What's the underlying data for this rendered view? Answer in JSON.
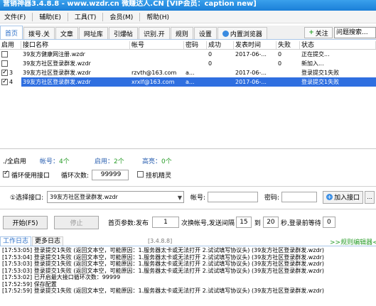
{
  "window": {
    "title": "营销神器3.4.8.8 - www.wzdr.cn 微赚达人.CN [VIP会员：caption new]"
  },
  "menu": [
    {
      "label": "文件(F)"
    },
    {
      "label": "辅助(E)"
    },
    {
      "label": "工具(T)"
    },
    {
      "label": "会员(M)"
    },
    {
      "label": "帮助(H)"
    }
  ],
  "tabs": [
    {
      "label": "首页",
      "active": true
    },
    {
      "label": "拨号.关"
    },
    {
      "label": "文章"
    },
    {
      "label": "网址库"
    },
    {
      "label": "引爆帖"
    },
    {
      "label": "识别.开"
    },
    {
      "label": "规则"
    },
    {
      "label": "设置"
    },
    {
      "label": "内置浏览器",
      "icon": "globe-icon"
    }
  ],
  "toolbar": {
    "follow_label": "关注",
    "search_value": "问题搜索..."
  },
  "grid": {
    "columns": [
      "启用",
      "接口名称",
      "帐号",
      "密码",
      "成功",
      "发表时间",
      "失败",
      "状态"
    ],
    "rows": [
      {
        "enabled": false,
        "num": "",
        "name": "39友方健康网注册.wzdr",
        "account": "",
        "password": "",
        "success": "0",
        "time": "2017-06-...",
        "fail": "0",
        "status": "正在提交...",
        "selected": false
      },
      {
        "enabled": false,
        "num": "",
        "name": "39友方社区登录群发.wzdr",
        "account": "",
        "password": "",
        "success": "0",
        "time": "",
        "fail": "0",
        "status": "新加入...",
        "selected": false
      },
      {
        "enabled": true,
        "num": "3",
        "name": "39友方社区登录群发.wzdr",
        "account": "rzvth@163.com",
        "password": "a...",
        "success": "",
        "time": "2017-06-...",
        "fail": "",
        "status": "登录提交1失败",
        "selected": false
      },
      {
        "enabled": true,
        "num": "4",
        "name": "39友方社区登录群发.wzdr",
        "account": "xrxlf@163.com",
        "password": "a...",
        "success": "",
        "time": "2017-06-...",
        "fail": "",
        "status": "登录提交1失败",
        "selected": true
      }
    ]
  },
  "stats": {
    "select_all": "全启用",
    "account_label": "帐号：",
    "account_value": "4个",
    "start_label": "启用：",
    "start_value": "2个",
    "high_label": "高亮：",
    "high_value": "0个"
  },
  "loop": {
    "checkbox_label": "循环使用接口",
    "checked": true,
    "count_label": "循环次数:",
    "count_value": "99999",
    "hang_label": "挂机精灵",
    "hang_checked": false
  },
  "selector": {
    "interface_label": "①选择接口:",
    "interface_value": "39友方社区登录群发.wzdr",
    "account_label": "帐号:",
    "account_value": "",
    "password_label": "密码:",
    "password_value": "",
    "add_label": "加入接口",
    "small_label": "..."
  },
  "controls": {
    "start_label": "开始(F5)",
    "stop_label": "停止",
    "params_label": "首页参数:发布",
    "publish_value": "1",
    "switch_label": "次换帐号,发送间隔",
    "interval_from": "15",
    "to_label": "到",
    "interval_to": "20",
    "sec_label": "秒,登录前等待",
    "wait_value": "0"
  },
  "log_tabs": [
    {
      "label": "工作日志",
      "active": true
    },
    {
      "label": "更多日志"
    }
  ],
  "version": "[3.4.8.8]",
  "editor_link": ">>规则编辑器<<",
  "log_lines": [
    "[17:53:05] 登录提交1失败 (返回文本空，可能原因：1.服务器太卡或无法打开 2.试试填写协议头) (39友方社区登录群发.wzdr)",
    "[17:53:04] 登录提交1失败 (返回文本空，可能原因：1.服务器太卡或无法打开 2.试试填写协议头) (39友方社区登录群发.wzdr)",
    "[17:53:03] 登录提交1失败 (返回文本空，可能原因：1.服务器太卡或无法打开 2.试试填写协议头) (39友方社区登录群发.wzdr)",
    "[17:53:03] 登录提交1失败 (返回文本空，可能原因：1.服务器太卡或无法打开 2.试试填写协议头) (39友方社区登录群发.wzdr)",
    "[17:53:02] 已开启最大接口循环次数：99999",
    "[17:52:59] 保存配置",
    "[17:52:59] 登录提交1失败 (返回文本空，可能原因：1.服务器太卡或无法打开 2.试试填写协议头) (39友方社区登录群发.wzdr)"
  ],
  "colors": {
    "title_bar": "#1a7fd8",
    "selection": "#2f6fe0",
    "link_green": "#2a9d2a",
    "label_blue": "#2a5fb0"
  }
}
